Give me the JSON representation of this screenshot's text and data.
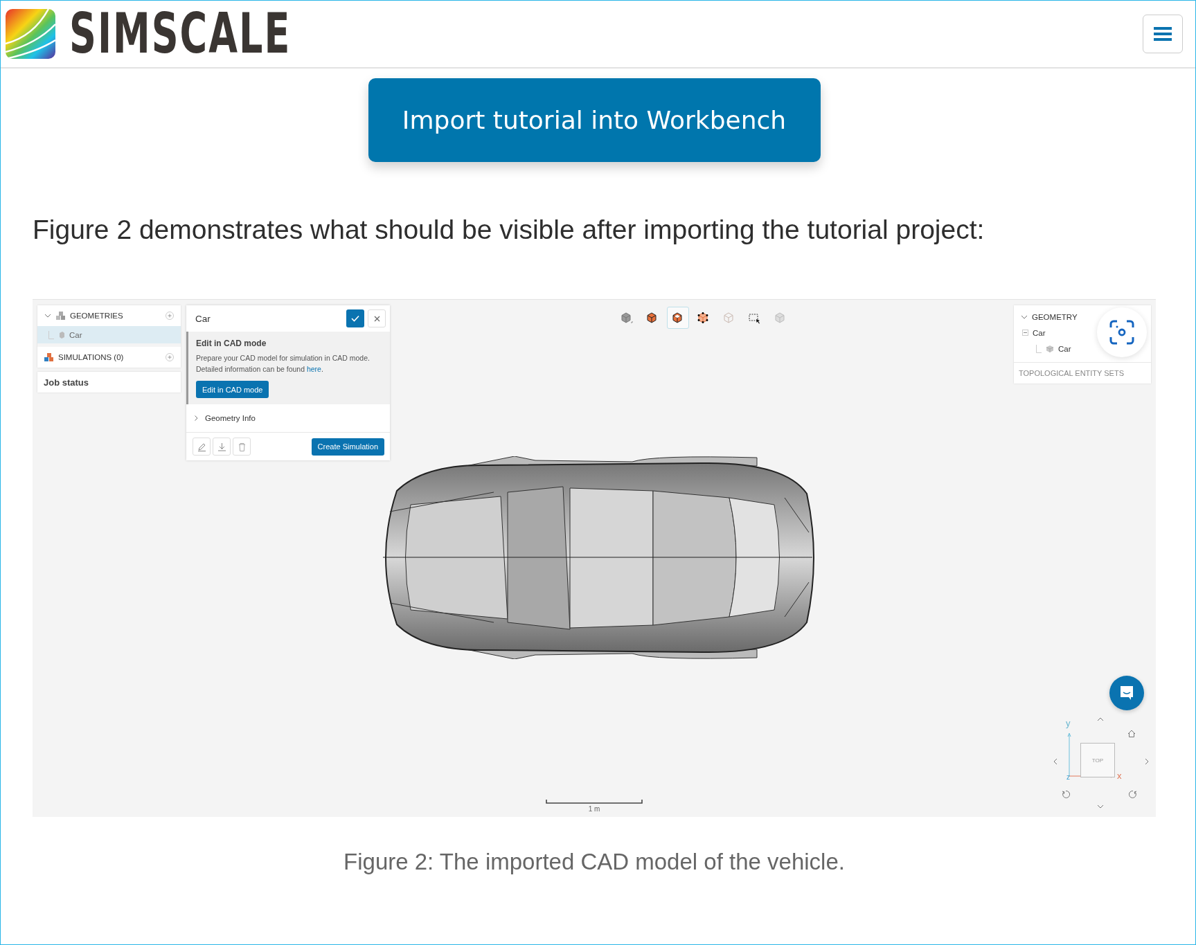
{
  "header": {
    "logo_text": "SIMSCALE"
  },
  "import_button": "Import tutorial into Workbench",
  "intro": "Figure 2 demonstrates what should be visible after importing the tutorial project:",
  "figure": {
    "tree": [
      {
        "label": "GEOMETRIES",
        "kind": "geometries",
        "expanded": true,
        "children": [
          {
            "label": "Car",
            "selected": true
          }
        ]
      },
      {
        "label": "SIMULATIONS (0)",
        "kind": "simulations"
      }
    ],
    "job_status": "Job status",
    "dialog": {
      "title": "Car",
      "heading": "Edit in CAD mode",
      "text": "Prepare your CAD model for simulation in CAD mode.\nDetailed information can be found ",
      "link": "here",
      "text_end": ".",
      "cad_button": "Edit in CAD mode",
      "section": "Geometry Info",
      "create_button": "Create Simulation"
    },
    "toolbar": [
      {
        "kind": "shaded",
        "selected": false
      },
      {
        "kind": "solid",
        "selected": false
      },
      {
        "kind": "faces",
        "selected": true
      },
      {
        "kind": "vertices",
        "selected": false
      },
      {
        "kind": "wire",
        "selected": false
      },
      {
        "kind": "box-select",
        "selected": false
      },
      {
        "kind": "hide",
        "selected": false
      }
    ],
    "geometry_panel": {
      "title": "GEOMETRY",
      "expanded": true,
      "items": [
        {
          "label": "Car",
          "expanded": true,
          "children": [
            {
              "label": "Car"
            }
          ]
        }
      ],
      "footer": "TOPOLOGICAL ENTITY SETS"
    },
    "scale_label": "1 m",
    "view_cube": {
      "face": "TOP",
      "y_label": "y",
      "x_label": "x",
      "z_label": "z"
    }
  },
  "caption": "Figure 2: The imported CAD model of the vehicle."
}
